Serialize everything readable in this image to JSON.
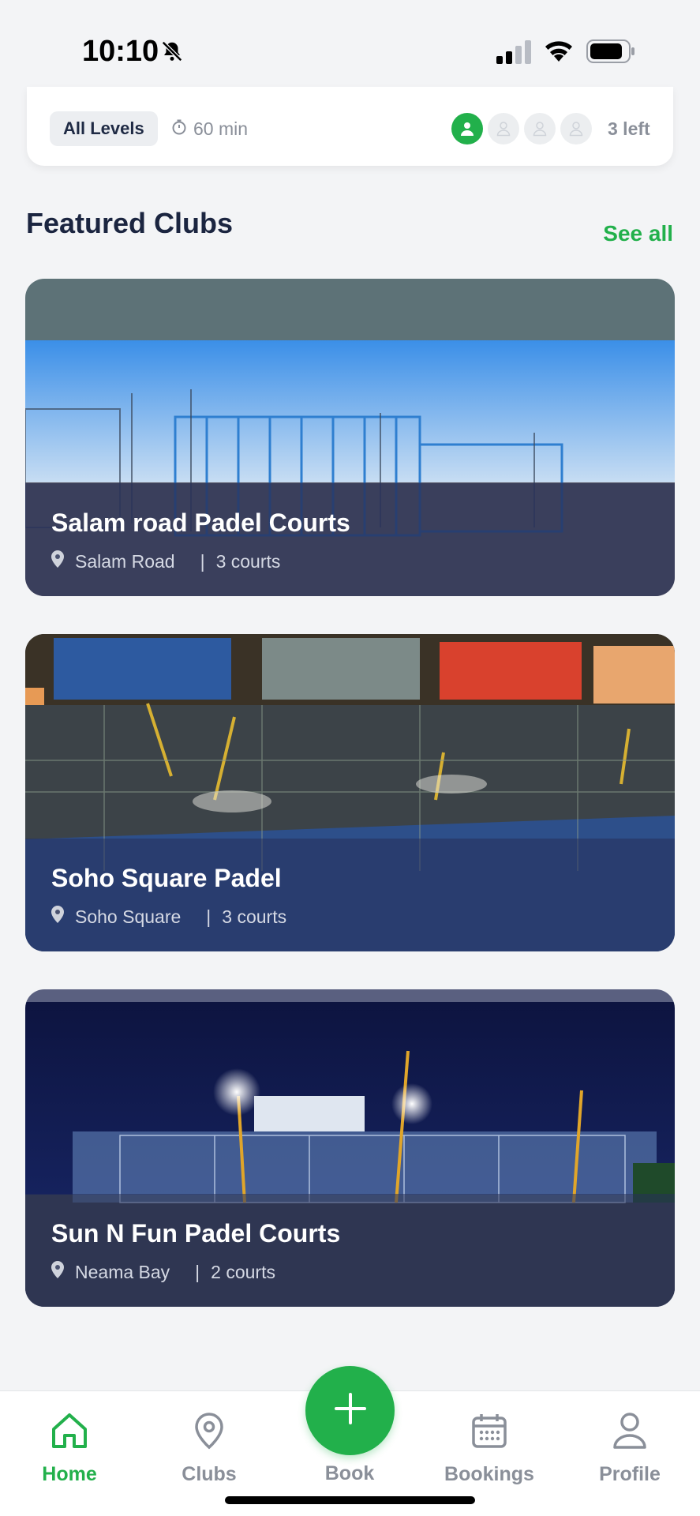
{
  "status_bar": {
    "time": "10:10",
    "icons": [
      "bell-slash-icon",
      "signal-icon",
      "wifi-icon",
      "battery-icon"
    ]
  },
  "session_card": {
    "level": "All Levels",
    "duration": "60 min",
    "players_filled": 1,
    "players_total": 4,
    "spots_left": "3 left"
  },
  "featured": {
    "title": "Featured Clubs",
    "see_all": "See all",
    "clubs": [
      {
        "name": "Salam road Padel Courts",
        "location": "Salam Road",
        "courts": "3 courts"
      },
      {
        "name": "Soho Square Padel",
        "location": "Soho Square",
        "courts": "3 courts"
      },
      {
        "name": "Sun N Fun Padel Courts",
        "location": "Neama Bay",
        "courts": "2 courts"
      }
    ]
  },
  "nav": {
    "home": "Home",
    "clubs": "Clubs",
    "book": "Book",
    "bookings": "Bookings",
    "profile": "Profile"
  },
  "colors": {
    "accent": "#22b04b",
    "muted": "#8a8f99",
    "heading": "#1b2540"
  }
}
